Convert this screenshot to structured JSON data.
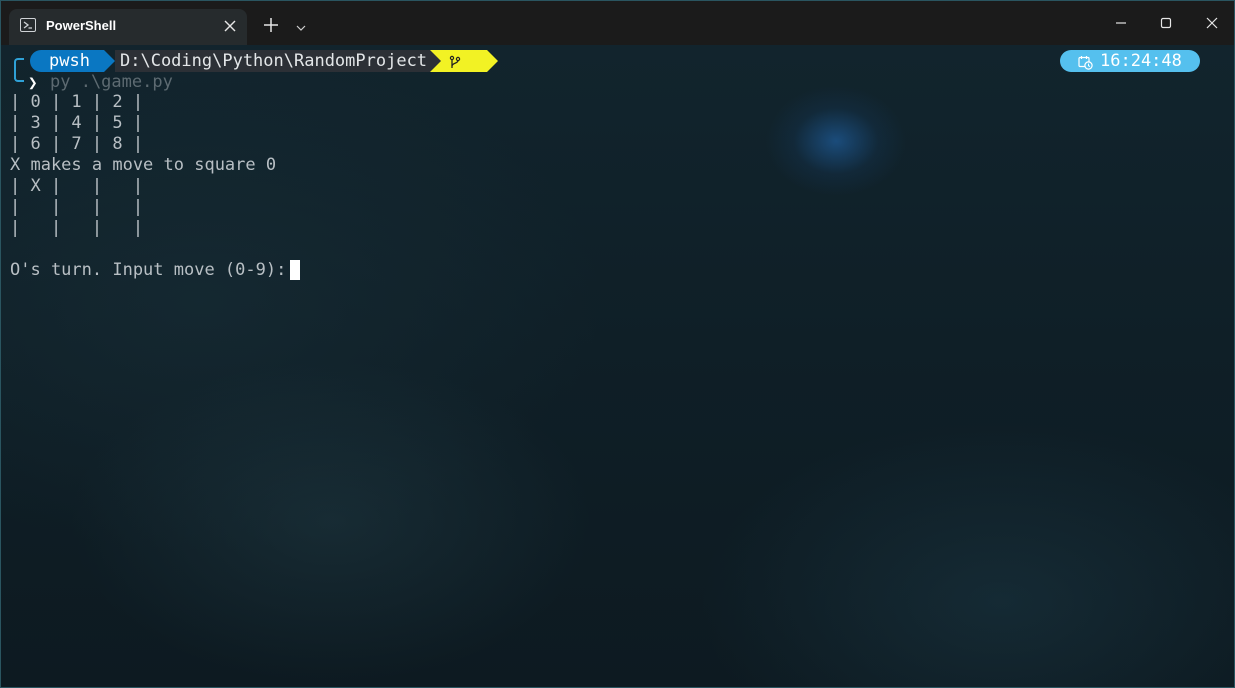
{
  "window": {
    "tab_title": "PowerShell",
    "tab_icon": "powershell-icon"
  },
  "prompt": {
    "shell": "pwsh",
    "path": "D:\\Coding\\Python\\RandomProject",
    "git_icon": "git-branch-icon",
    "chevron": "❯",
    "command": "py .\\game.py",
    "clock_icon": "calendar-clock-icon",
    "time": "16:24:48"
  },
  "output": {
    "lines": [
      "| 0 | 1 | 2 |",
      "| 3 | 4 | 5 |",
      "| 6 | 7 | 8 |",
      "X makes a move to square 0",
      "| X |   |   |",
      "|   |   |   |",
      "|   |   |   |",
      "",
      "O's turn. Input move (0-9): "
    ]
  },
  "colors": {
    "pwsh_segment": "#0a77c2",
    "path_segment": "#2c3036",
    "git_segment": "#f2f224",
    "clock_segment": "#55c0ee",
    "text": "#b8bfc4"
  }
}
